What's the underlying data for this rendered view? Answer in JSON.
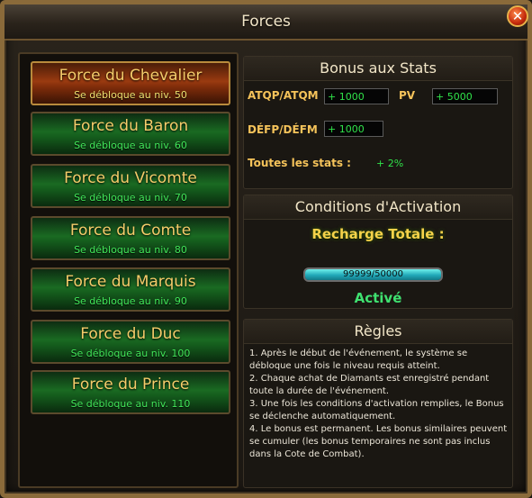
{
  "window": {
    "title": "Forces",
    "close_icon": "close-icon",
    "close_glyph": "✕"
  },
  "forces": [
    {
      "name": "Force du Chevalier",
      "requirement": "Se débloque au niv. 50",
      "selected": true
    },
    {
      "name": "Force du Baron",
      "requirement": "Se débloque au niv. 60",
      "selected": false
    },
    {
      "name": "Force du Vicomte",
      "requirement": "Se débloque au niv. 70",
      "selected": false
    },
    {
      "name": "Force du Comte",
      "requirement": "Se débloque au niv. 80",
      "selected": false
    },
    {
      "name": "Force du Marquis",
      "requirement": "Se débloque au niv. 90",
      "selected": false
    },
    {
      "name": "Force du Duc",
      "requirement": "Se débloque au niv. 100",
      "selected": false
    },
    {
      "name": "Force du Prince",
      "requirement": "Se débloque au niv. 110",
      "selected": false
    }
  ],
  "bonus": {
    "title": "Bonus aux Stats",
    "atk_label": "ATQP/ATQM",
    "atk_value": "+ 1000",
    "pv_label": "PV",
    "pv_value": "+ 5000",
    "def_label": "DÉFP/DÉFM",
    "def_value": "+ 1000",
    "all_label": "Toutes les stats :",
    "all_value": "+ 2%"
  },
  "conditions": {
    "title": "Conditions d'Activation",
    "recharge_label": "Recharge Totale :",
    "progress_text": "99999/50000",
    "progress_fraction": 1.0,
    "status": "Activé"
  },
  "rules": {
    "title": "Règles",
    "lines": [
      "1. Après le début de l'événement, le système se débloque une fois le niveau requis atteint.",
      "2. Chaque achat de Diamants est enregistré pendant toute la durée de l'événement.",
      "3. Une fois les conditions d'activation remplies, le Bonus se déclenche automatiquement.",
      "4. Le bonus est permanent. Les bonus similaires peuvent se cumuler (les bonus temporaires ne sont pas inclus dans la Cote de Combat)."
    ]
  },
  "colors": {
    "accent_gold": "#f5cc6a",
    "active_green": "#3fe070",
    "progress_cyan": "#20a8b8"
  }
}
